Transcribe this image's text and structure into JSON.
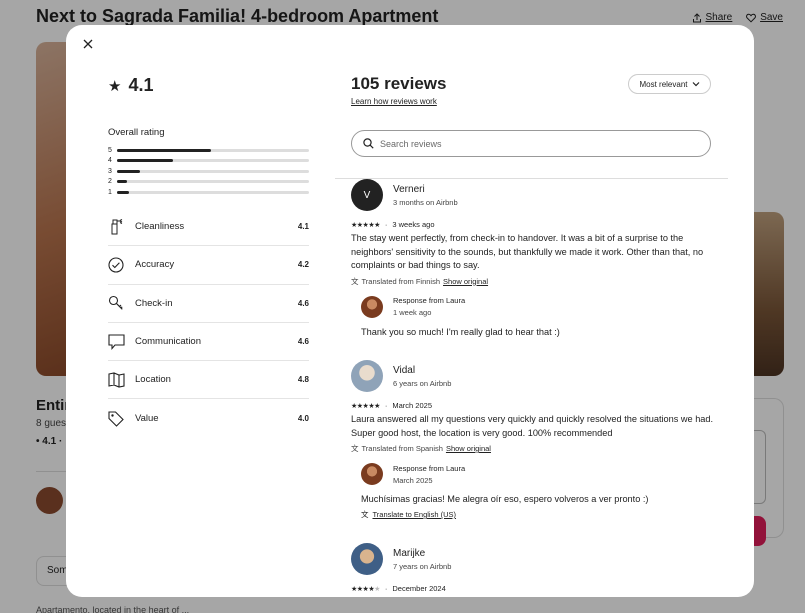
{
  "listing": {
    "title": "Next to Sagrada Familia! 4-bedroom Apartment",
    "share_label": "Share",
    "save_label": "Save",
    "entire_partial": "Entir",
    "guests_partial": "8 gues",
    "rating_partial": "• 4.1 ·",
    "button_partial": "Som",
    "bottom_partial": "Apartamento, located in the heart of ..."
  },
  "modal": {
    "rating_avg": "4.1",
    "overall_label": "Overall rating",
    "distribution": [
      {
        "stars": "5",
        "fraction": 0.49
      },
      {
        "stars": "4",
        "fraction": 0.29
      },
      {
        "stars": "3",
        "fraction": 0.12
      },
      {
        "stars": "2",
        "fraction": 0.05
      },
      {
        "stars": "1",
        "fraction": 0.06
      }
    ],
    "categories": [
      {
        "label": "Cleanliness",
        "score": "4.1",
        "icon": "spray-bottle-icon"
      },
      {
        "label": "Accuracy",
        "score": "4.2",
        "icon": "check-circle-icon"
      },
      {
        "label": "Check-in",
        "score": "4.6",
        "icon": "key-icon"
      },
      {
        "label": "Communication",
        "score": "4.6",
        "icon": "chat-bubble-icon"
      },
      {
        "label": "Location",
        "score": "4.8",
        "icon": "map-icon"
      },
      {
        "label": "Value",
        "score": "4.0",
        "icon": "tag-icon"
      }
    ],
    "reviews_title": "105 reviews",
    "learn_link": "Learn how reviews work",
    "sort_label": "Most relevant",
    "search_placeholder": "Search reviews",
    "reviews": [
      {
        "name": "Verneri",
        "initial": "V",
        "meta": "3 months on Airbnb",
        "stars": 5,
        "date": "3 weeks ago",
        "text": "The stay went perfectly, from check-in to handover. It was a bit of a surprise to the neighbors' sensitivity to the sounds, but thankfully we made it work. Other than that, no complaints or bad things to say.",
        "translated": "Translated from Finnish",
        "show_original": "Show original",
        "response": {
          "label": "Response from Laura",
          "date": "1 week ago",
          "text": "Thank you so much! I'm really glad to hear that :)"
        }
      },
      {
        "name": "Vidal",
        "meta": "6 years on Airbnb",
        "stars": 5,
        "date": "March 2025",
        "text": "Laura answered all my questions very quickly and quickly resolved the situations we had. Super good host, the location is very good. 100% recommended",
        "translated": "Translated from Spanish",
        "show_original": "Show original",
        "response": {
          "label": "Response from Laura",
          "date": "March 2025",
          "text": "Muchísimas gracias! Me alegra oír eso, espero volveros a ver pronto :)",
          "translate_link": "Translate to English (US)"
        }
      },
      {
        "name": "Marijke",
        "meta": "7 years on Airbnb",
        "stars": 4,
        "date": "December 2024"
      }
    ]
  },
  "colors": {
    "text": "#222222",
    "overlay": "rgba(0,0,0,0.35)",
    "brand_pink": "#e01d5a"
  }
}
